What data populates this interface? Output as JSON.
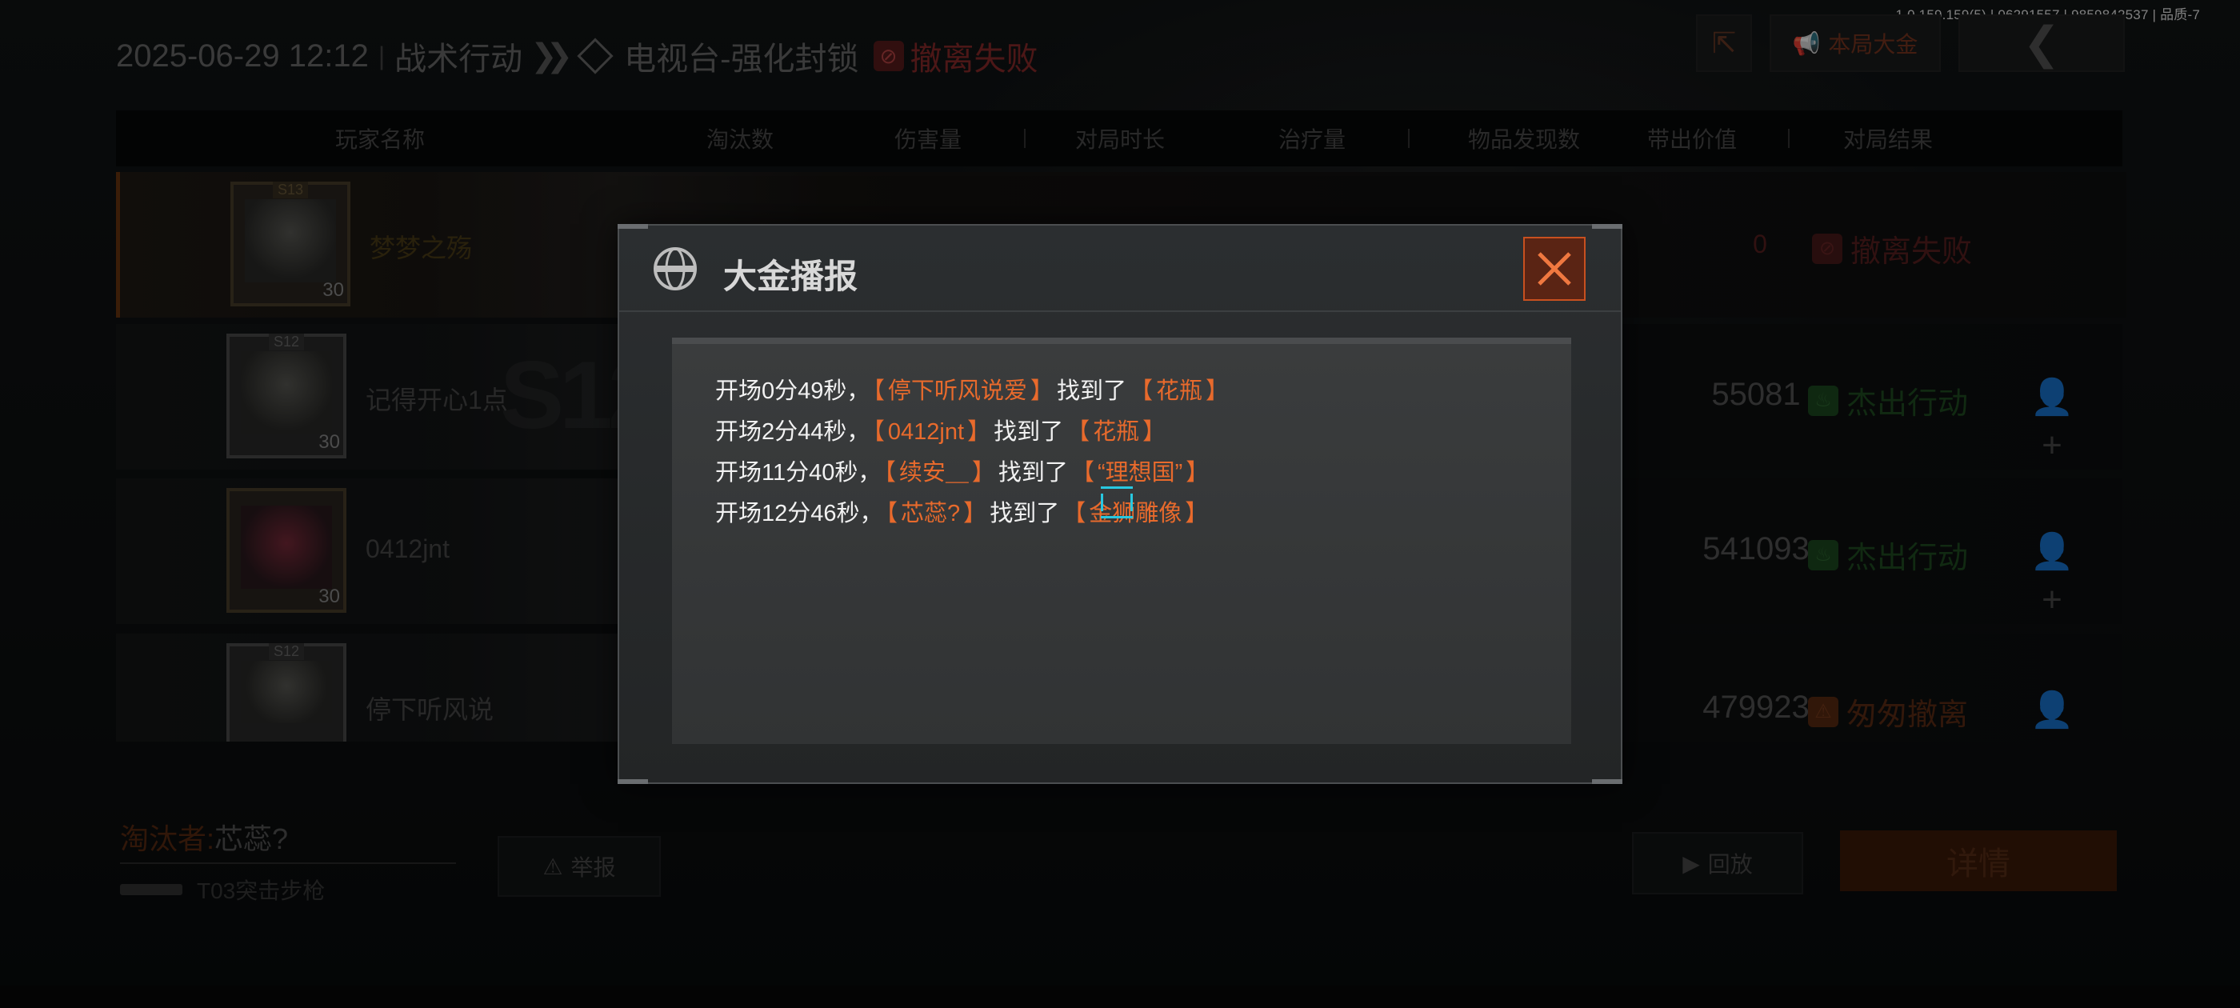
{
  "version": "1.0.159.159(5) | 06291557 | 9859842537 | 品质-7",
  "header": {
    "datetime": "2025-06-29 12:12",
    "mode": "战术行动",
    "map": "电视台-强化封锁",
    "status": "撤离失败"
  },
  "top_buttons": {
    "gold_label": "本局大金"
  },
  "table": {
    "columns": [
      "玩家名称",
      "淘汰数",
      "伤害量",
      "对局时长",
      "治疗量",
      "物品发现数",
      "带出价值",
      "对局结果"
    ],
    "rows": [
      {
        "name": "梦梦之殇",
        "season": "S13",
        "level": "30",
        "value": "0",
        "result": "撤离失败",
        "result_type": "fail",
        "is_self": true
      },
      {
        "name": "记得开心1点",
        "season": "S12",
        "level": "30",
        "value": "55081",
        "result": "杰出行动",
        "result_type": "good",
        "is_self": false
      },
      {
        "name": "0412jnt",
        "season": "",
        "level": "30",
        "value": "541093",
        "result": "杰出行动",
        "result_type": "good",
        "is_self": false
      },
      {
        "name": "停下听风说",
        "season": "S12",
        "level": "",
        "value": "479923",
        "result": "匆匆撤离",
        "result_type": "warn",
        "is_self": false
      }
    ]
  },
  "bottom": {
    "killer_label": "淘汰者:",
    "killer_name": "芯蕊?",
    "weapon": "T03突击步枪",
    "report_label": "举报",
    "replay_label": "回放",
    "detail_label": "详情"
  },
  "modal": {
    "title": "大金播报",
    "entries": [
      {
        "time": "开场0分49秒，",
        "player": "停下听风说爱",
        "found": "找到了",
        "item": "花瓶"
      },
      {
        "time": "开场2分44秒，",
        "player": "0412jnt",
        "found": "找到了",
        "item": "花瓶"
      },
      {
        "time": "开场11分40秒，",
        "player": "续安＿",
        "found": "找到了",
        "item": "“理想国”"
      },
      {
        "time": "开场12分46秒，",
        "player": "芯蕊?",
        "found": "找到了",
        "item": "金狮雕像"
      }
    ]
  },
  "colors": {
    "accent_orange": "#e86a2c",
    "close_border": "#c8501f",
    "cursor": "#28c8e0"
  }
}
